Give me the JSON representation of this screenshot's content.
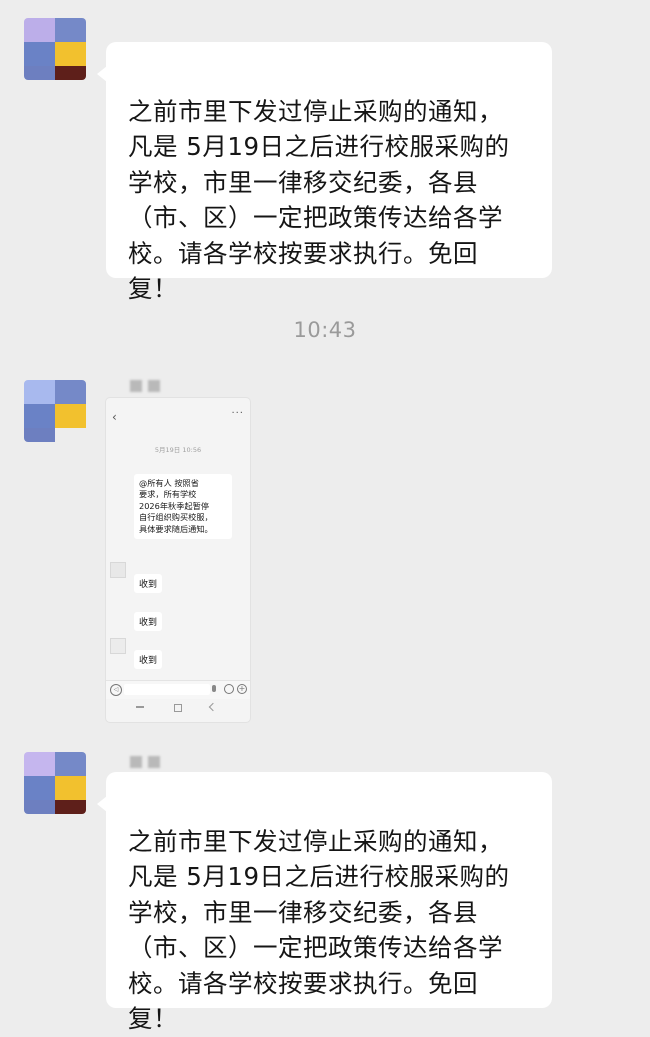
{
  "messages": [
    {
      "text": "之前市里下发过停止采购的通知，\n凡是 5月19日之后进行校服采购的\n学校，市里一律移交纪委，各县\n（市、区）一定把政策传达给各学\n校。请各学校按要求执行。免回\n复！"
    },
    {
      "text": "之前市里下发过停止采购的通知，\n凡是 5月19日之后进行校服采购的\n学校，市里一律移交纪委，各县\n（市、区）一定把政策传达给各学\n校。请各学校按要求执行。免回\n复！"
    }
  ],
  "timestamp": "10:43",
  "image_message": {
    "back_icon": "‹",
    "more_icon": "···",
    "time": "5月19日 10:56",
    "notice_text": "@所有人  按照省\n要求，所有学校\n2026年秋季起暂停\n自行组织购买校服，\n具体要求随后通知。",
    "replies": [
      "收到",
      "收到",
      "收到"
    ]
  },
  "colors": {
    "background": "#ededed",
    "bubble": "#ffffff",
    "timestamp": "#9a9a9a"
  },
  "avatar_colors": [
    "#b9a9e8",
    "#7b8ec9",
    "#6f86c7",
    "#f2c12e",
    "#6d7fc0",
    "#5e1f1a"
  ]
}
